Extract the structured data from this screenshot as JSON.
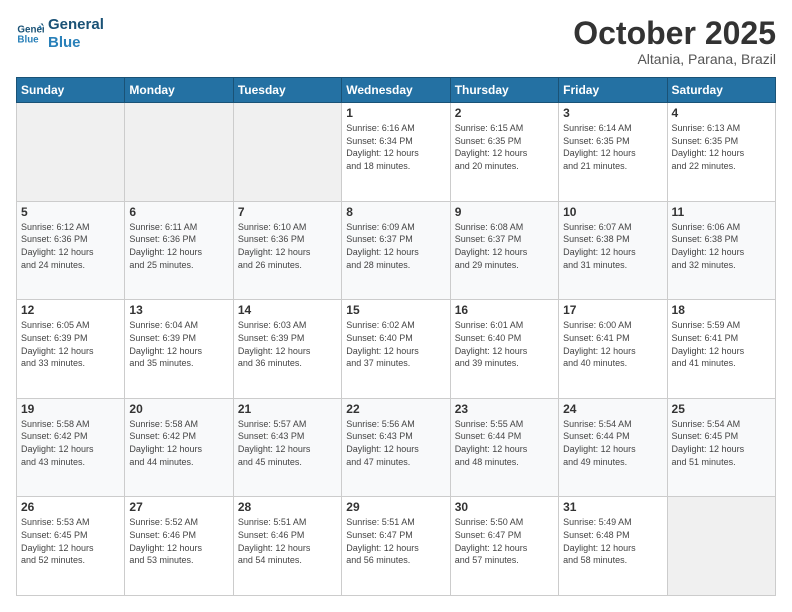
{
  "logo": {
    "line1": "General",
    "line2": "Blue"
  },
  "header": {
    "month": "October 2025",
    "location": "Altania, Parana, Brazil"
  },
  "days_of_week": [
    "Sunday",
    "Monday",
    "Tuesday",
    "Wednesday",
    "Thursday",
    "Friday",
    "Saturday"
  ],
  "weeks": [
    [
      {
        "day": "",
        "info": ""
      },
      {
        "day": "",
        "info": ""
      },
      {
        "day": "",
        "info": ""
      },
      {
        "day": "1",
        "info": "Sunrise: 6:16 AM\nSunset: 6:34 PM\nDaylight: 12 hours\nand 18 minutes."
      },
      {
        "day": "2",
        "info": "Sunrise: 6:15 AM\nSunset: 6:35 PM\nDaylight: 12 hours\nand 20 minutes."
      },
      {
        "day": "3",
        "info": "Sunrise: 6:14 AM\nSunset: 6:35 PM\nDaylight: 12 hours\nand 21 minutes."
      },
      {
        "day": "4",
        "info": "Sunrise: 6:13 AM\nSunset: 6:35 PM\nDaylight: 12 hours\nand 22 minutes."
      }
    ],
    [
      {
        "day": "5",
        "info": "Sunrise: 6:12 AM\nSunset: 6:36 PM\nDaylight: 12 hours\nand 24 minutes."
      },
      {
        "day": "6",
        "info": "Sunrise: 6:11 AM\nSunset: 6:36 PM\nDaylight: 12 hours\nand 25 minutes."
      },
      {
        "day": "7",
        "info": "Sunrise: 6:10 AM\nSunset: 6:36 PM\nDaylight: 12 hours\nand 26 minutes."
      },
      {
        "day": "8",
        "info": "Sunrise: 6:09 AM\nSunset: 6:37 PM\nDaylight: 12 hours\nand 28 minutes."
      },
      {
        "day": "9",
        "info": "Sunrise: 6:08 AM\nSunset: 6:37 PM\nDaylight: 12 hours\nand 29 minutes."
      },
      {
        "day": "10",
        "info": "Sunrise: 6:07 AM\nSunset: 6:38 PM\nDaylight: 12 hours\nand 31 minutes."
      },
      {
        "day": "11",
        "info": "Sunrise: 6:06 AM\nSunset: 6:38 PM\nDaylight: 12 hours\nand 32 minutes."
      }
    ],
    [
      {
        "day": "12",
        "info": "Sunrise: 6:05 AM\nSunset: 6:39 PM\nDaylight: 12 hours\nand 33 minutes."
      },
      {
        "day": "13",
        "info": "Sunrise: 6:04 AM\nSunset: 6:39 PM\nDaylight: 12 hours\nand 35 minutes."
      },
      {
        "day": "14",
        "info": "Sunrise: 6:03 AM\nSunset: 6:39 PM\nDaylight: 12 hours\nand 36 minutes."
      },
      {
        "day": "15",
        "info": "Sunrise: 6:02 AM\nSunset: 6:40 PM\nDaylight: 12 hours\nand 37 minutes."
      },
      {
        "day": "16",
        "info": "Sunrise: 6:01 AM\nSunset: 6:40 PM\nDaylight: 12 hours\nand 39 minutes."
      },
      {
        "day": "17",
        "info": "Sunrise: 6:00 AM\nSunset: 6:41 PM\nDaylight: 12 hours\nand 40 minutes."
      },
      {
        "day": "18",
        "info": "Sunrise: 5:59 AM\nSunset: 6:41 PM\nDaylight: 12 hours\nand 41 minutes."
      }
    ],
    [
      {
        "day": "19",
        "info": "Sunrise: 5:58 AM\nSunset: 6:42 PM\nDaylight: 12 hours\nand 43 minutes."
      },
      {
        "day": "20",
        "info": "Sunrise: 5:58 AM\nSunset: 6:42 PM\nDaylight: 12 hours\nand 44 minutes."
      },
      {
        "day": "21",
        "info": "Sunrise: 5:57 AM\nSunset: 6:43 PM\nDaylight: 12 hours\nand 45 minutes."
      },
      {
        "day": "22",
        "info": "Sunrise: 5:56 AM\nSunset: 6:43 PM\nDaylight: 12 hours\nand 47 minutes."
      },
      {
        "day": "23",
        "info": "Sunrise: 5:55 AM\nSunset: 6:44 PM\nDaylight: 12 hours\nand 48 minutes."
      },
      {
        "day": "24",
        "info": "Sunrise: 5:54 AM\nSunset: 6:44 PM\nDaylight: 12 hours\nand 49 minutes."
      },
      {
        "day": "25",
        "info": "Sunrise: 5:54 AM\nSunset: 6:45 PM\nDaylight: 12 hours\nand 51 minutes."
      }
    ],
    [
      {
        "day": "26",
        "info": "Sunrise: 5:53 AM\nSunset: 6:45 PM\nDaylight: 12 hours\nand 52 minutes."
      },
      {
        "day": "27",
        "info": "Sunrise: 5:52 AM\nSunset: 6:46 PM\nDaylight: 12 hours\nand 53 minutes."
      },
      {
        "day": "28",
        "info": "Sunrise: 5:51 AM\nSunset: 6:46 PM\nDaylight: 12 hours\nand 54 minutes."
      },
      {
        "day": "29",
        "info": "Sunrise: 5:51 AM\nSunset: 6:47 PM\nDaylight: 12 hours\nand 56 minutes."
      },
      {
        "day": "30",
        "info": "Sunrise: 5:50 AM\nSunset: 6:47 PM\nDaylight: 12 hours\nand 57 minutes."
      },
      {
        "day": "31",
        "info": "Sunrise: 5:49 AM\nSunset: 6:48 PM\nDaylight: 12 hours\nand 58 minutes."
      },
      {
        "day": "",
        "info": ""
      }
    ]
  ]
}
